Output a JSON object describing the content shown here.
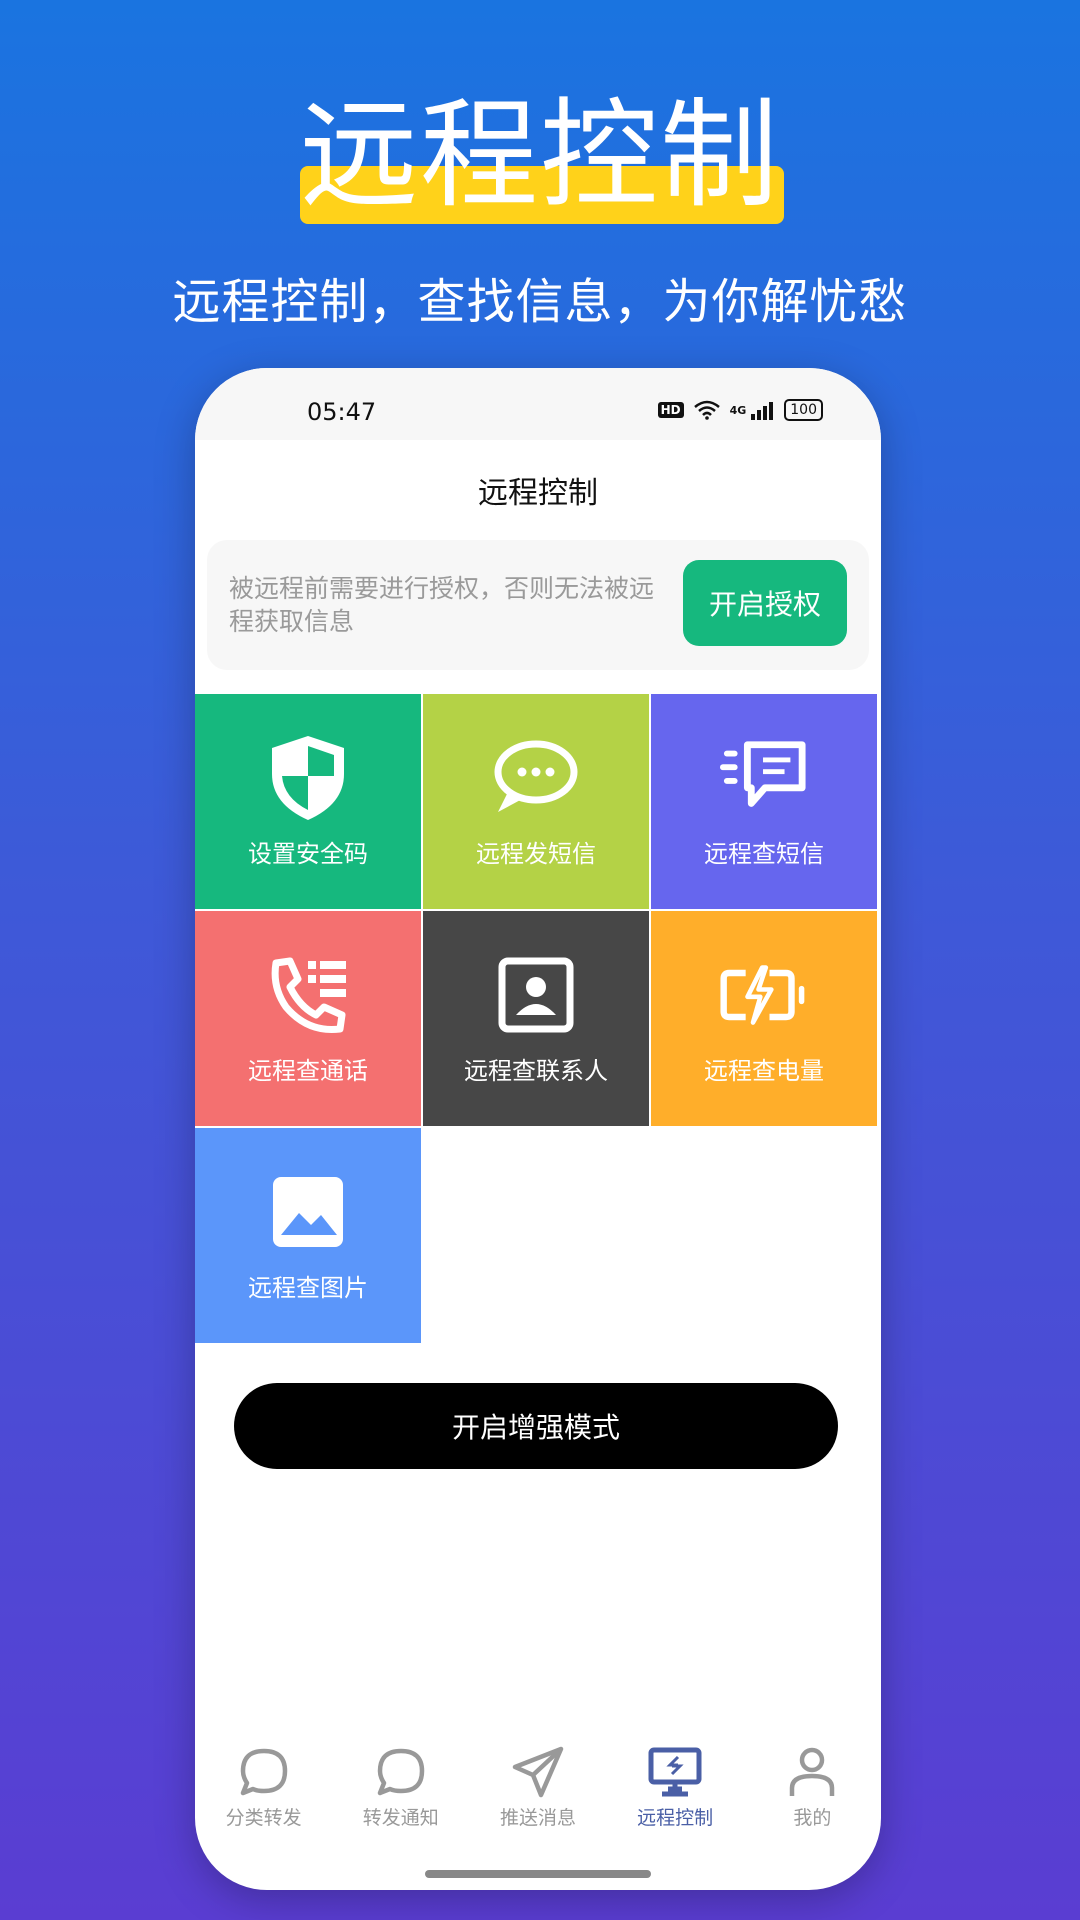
{
  "promo": {
    "headline": "远程控制",
    "subline": "远程控制，查找信息，为你解忧愁"
  },
  "status_bar": {
    "time": "05:47",
    "hd": "HD",
    "network": "4G",
    "battery": "100"
  },
  "app_bar": {
    "title": "远程控制"
  },
  "notice": {
    "text": "被远程前需要进行授权，否则无法被远程获取信息",
    "button_label": "开启授权"
  },
  "tiles": [
    {
      "label": "设置安全码",
      "icon": "shield-icon",
      "color": "#16b87e"
    },
    {
      "label": "远程发短信",
      "icon": "chat-bubble-icon",
      "color": "#b4d246"
    },
    {
      "label": "远程查短信",
      "icon": "message-list-icon",
      "color": "#6666ee"
    },
    {
      "label": "远程查通话",
      "icon": "phone-list-icon",
      "color": "#f47070"
    },
    {
      "label": "远程查联系人",
      "icon": "contact-icon",
      "color": "#474747"
    },
    {
      "label": "远程查电量",
      "icon": "battery-charge-icon",
      "color": "#ffae2a"
    },
    {
      "label": "远程查图片",
      "icon": "image-icon",
      "color": "#5b96fa"
    }
  ],
  "enhance_button": {
    "label": "开启增强模式"
  },
  "tabs": [
    {
      "label": "分类转发",
      "icon": "chat-icon",
      "active": false
    },
    {
      "label": "转发通知",
      "icon": "chat-icon",
      "active": false
    },
    {
      "label": "推送消息",
      "icon": "send-icon",
      "active": false
    },
    {
      "label": "远程控制",
      "icon": "remote-desktop-icon",
      "active": true
    },
    {
      "label": "我的",
      "icon": "user-icon",
      "active": false
    }
  ],
  "colors": {
    "accent_green": "#16b87e",
    "tab_active": "#4a5fa6",
    "headline_bar": "#ffd21a"
  }
}
